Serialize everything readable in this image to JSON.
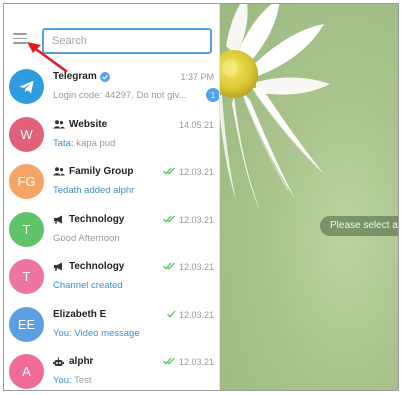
{
  "search": {
    "placeholder": "Search"
  },
  "chats": [
    {
      "name": "Telegram",
      "time": "1:37 PM",
      "preview": "Login code: 44297. Do not giv...",
      "badge": "1",
      "avatar_color": "#2f9be0"
    },
    {
      "name": "Website",
      "time": "14.05.21",
      "sender": "Tata:",
      "preview": "kapa pud",
      "avatar": "W",
      "avatar_color": "#e2607a"
    },
    {
      "name": "Family Group",
      "time": "12.03.21",
      "preview": "Tedath added alphr",
      "avatar": "FG",
      "avatar_color": "#f5a468"
    },
    {
      "name": "Technology",
      "time": "12.03.21",
      "preview": "Good Afternoon",
      "avatar": "T",
      "avatar_color": "#5fc36a"
    },
    {
      "name": "Technology",
      "time": "12.03.21",
      "preview": "Channel created",
      "avatar": "T",
      "avatar_color": "#ee74a4"
    },
    {
      "name": "Elizabeth E",
      "time": "12.03.21",
      "sender": "You:",
      "preview": "Video message",
      "avatar": "EE",
      "avatar_color": "#5b9fe0"
    },
    {
      "name": "alphr",
      "time": "12.03.21",
      "sender": "You:",
      "preview": "Test",
      "avatar": "A",
      "avatar_color": "#ee6b9a"
    }
  ],
  "main": {
    "empty_message": "Please select a c"
  },
  "colors": {
    "accent": "#54a3e0",
    "read_check": "#4fbe5a",
    "annotation_arrow": "#e01b1b"
  }
}
